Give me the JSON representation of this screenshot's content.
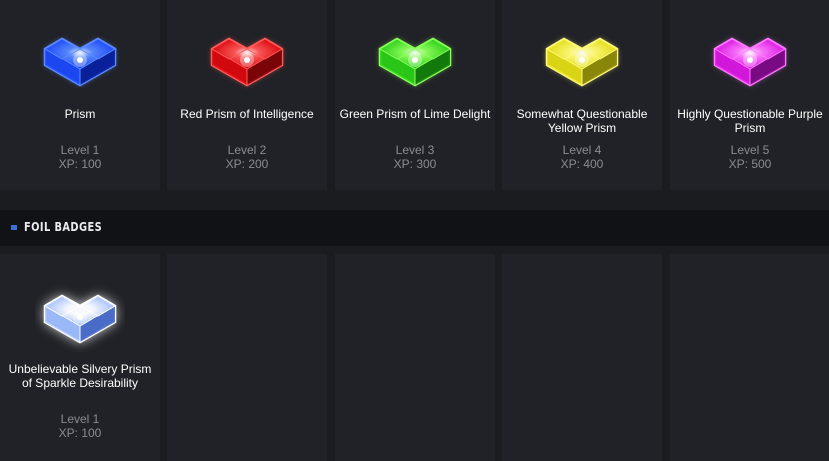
{
  "level_badges": [
    {
      "name": "Prism",
      "level": "Level 1",
      "xp": "XP: 100",
      "color": "#1e4dff",
      "color_dark": "#0a1f9a",
      "glow": "#5b8bff",
      "icon": "blue-prism-badge-icon"
    },
    {
      "name": "Red Prism of Intelligence",
      "level": "Level 2",
      "xp": "XP: 200",
      "color": "#e00a10",
      "color_dark": "#7a0408",
      "glow": "#ff5a5a",
      "icon": "red-prism-badge-icon"
    },
    {
      "name": "Green Prism of Lime Delight",
      "level": "Level 3",
      "xp": "XP: 300",
      "color": "#2fd41a",
      "color_dark": "#137a0a",
      "glow": "#8aff5a",
      "icon": "green-prism-badge-icon"
    },
    {
      "name": "Somewhat Questionable Yellow Prism",
      "level": "Level 4",
      "xp": "XP: 400",
      "color": "#e8e21a",
      "color_dark": "#8a860a",
      "glow": "#fffa7a",
      "icon": "yellow-prism-badge-icon"
    },
    {
      "name": "Highly Questionable Purple Prism",
      "level": "Level 5",
      "xp": "XP: 500",
      "color": "#e01ae8",
      "color_dark": "#7a0a84",
      "glow": "#ff7aff",
      "icon": "purple-prism-badge-icon"
    }
  ],
  "foil_section": {
    "title": "FOIL BADGES"
  },
  "foil_badges": [
    {
      "name": "Unbelievable Silvery Prism of Sparkle Desirability",
      "level": "Level 1",
      "xp": "XP: 100",
      "color": "#a8c4ff",
      "color_dark": "#4a6cc8",
      "glow": "#ffffff",
      "icon": "silver-foil-prism-badge-icon"
    }
  ],
  "empty_foil_slots": 4
}
